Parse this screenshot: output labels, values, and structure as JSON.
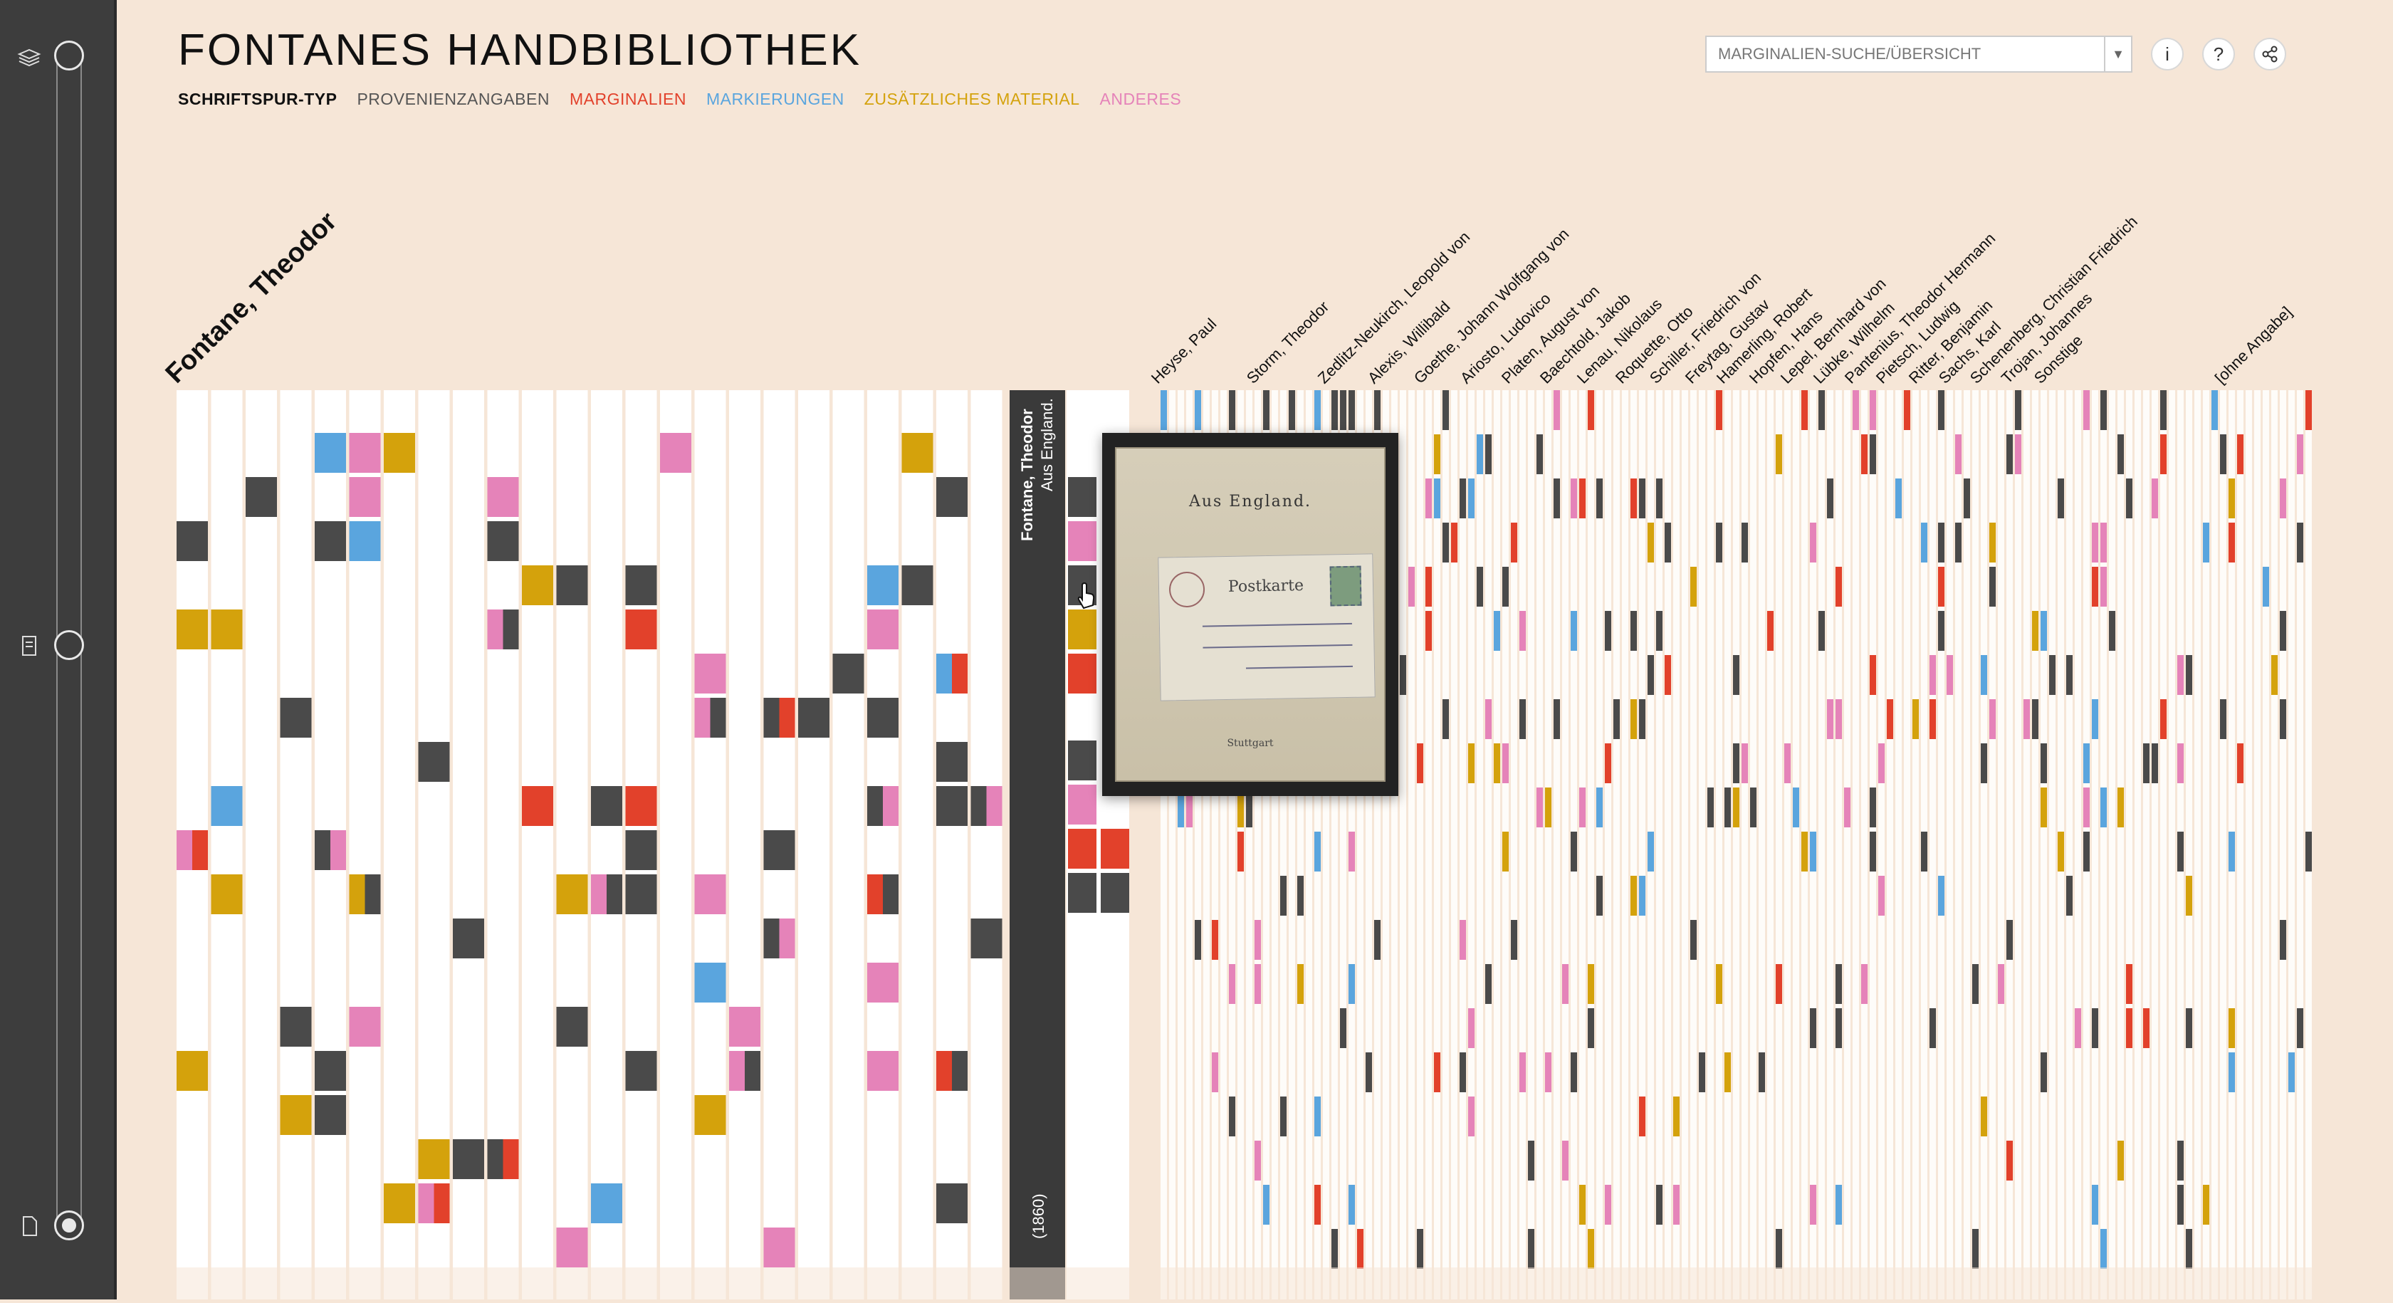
{
  "app": {
    "title": "FONTANES HANDBIBLIOTHEK"
  },
  "legend": {
    "type_label": "SCHRIFTSPUR-TYP",
    "items": [
      {
        "key": "P",
        "label": "PROVENIENZANGABEN",
        "color": "#4a4a4a"
      },
      {
        "key": "M",
        "label": "MARGINALIEN",
        "color": "#e2412b"
      },
      {
        "key": "K",
        "label": "MARKIERUNGEN",
        "color": "#5aa5de"
      },
      {
        "key": "Z",
        "label": "ZUSÄTZLICHES MATERIAL",
        "color": "#d4a20c"
      },
      {
        "key": "A",
        "label": "ANDERES",
        "color": "#e583b9"
      }
    ]
  },
  "search": {
    "placeholder": "MARGINALIEN-SUCHE/ÜBERSICHT"
  },
  "buttons": {
    "info": "i",
    "help": "?"
  },
  "sidebar": {
    "icons": [
      "library-icon",
      "book-icon",
      "page-icon"
    ]
  },
  "colors": {
    "background": "#f6e6d7",
    "column": "#ffffff",
    "selected_column": "#3a3a3a"
  },
  "authors": [
    {
      "name": "Fontane, Theodor",
      "bold": true
    },
    {
      "name": "Heyse, Paul"
    },
    {
      "name": "Storm, Theodor"
    },
    {
      "name": "Zedlitz-Neukirch, Leopold von"
    },
    {
      "name": "Alexis, Willibald"
    },
    {
      "name": "Goethe, Johann Wolfgang von"
    },
    {
      "name": "Ariosto, Ludovico"
    },
    {
      "name": "Platen, August von"
    },
    {
      "name": "Baechtold, Jakob"
    },
    {
      "name": "Lenau, Nikolaus"
    },
    {
      "name": "Roquette, Otto"
    },
    {
      "name": "Schiller, Friedrich von"
    },
    {
      "name": "Freytag, Gustav"
    },
    {
      "name": "Hamerling, Robert"
    },
    {
      "name": "Hopfen, Hans"
    },
    {
      "name": "Lepel, Bernhard von"
    },
    {
      "name": "Lübke, Wilhelm"
    },
    {
      "name": "Pantenius, Theodor Hermann"
    },
    {
      "name": "Pietsch, Ludwig"
    },
    {
      "name": "Ritter, Benjamin"
    },
    {
      "name": "Sachs, Karl"
    },
    {
      "name": "Schenenberg, Christian Friedrich"
    },
    {
      "name": "Trojan, Johannes"
    },
    {
      "name": "Sonstige"
    },
    {
      "name": "[ohne Angabe]"
    }
  ],
  "selected_book": {
    "author": "Fontane, Theodor",
    "title": "Aus England.",
    "year": "(1860)"
  },
  "tooltip": {
    "book_title": "Aus England.",
    "card_text": "Postkarte",
    "publisher": "Stuttgart"
  }
}
